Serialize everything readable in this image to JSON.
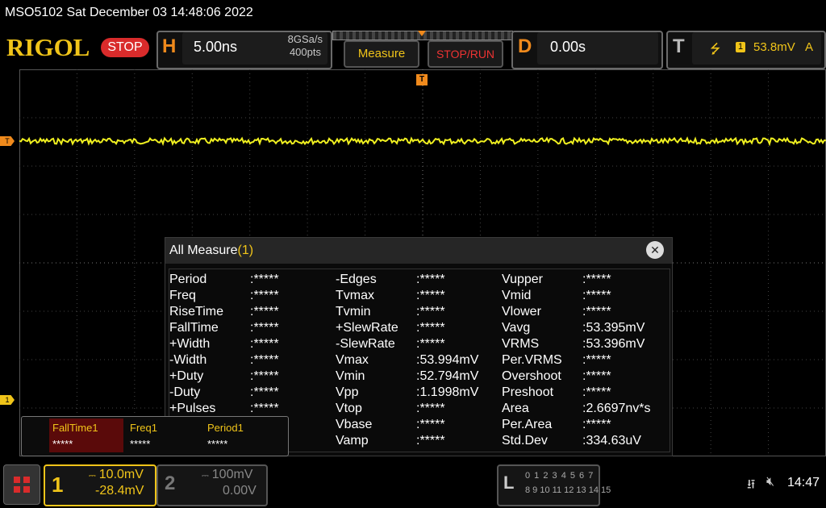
{
  "header": {
    "device_title": "MSO5102  Sat December 03 14:48:06 2022",
    "logo": "RIGOL",
    "run_state": "STOP"
  },
  "horizontal": {
    "letter": "H",
    "timebase": "5.00ns",
    "sample_rate": "8GSa/s",
    "points": "400pts"
  },
  "buttons": {
    "measure": "Measure",
    "stop_run": "STOP/RUN"
  },
  "delay": {
    "letter": "D",
    "value": "0.00s"
  },
  "trigger": {
    "letter": "T",
    "slope_icon": "rising-edge-icon",
    "source": "1",
    "level": "53.8mV",
    "mode": "A",
    "marker_label": "T",
    "channel_marker": "1"
  },
  "waveform": {
    "color": "#f0f020",
    "channel": 1
  },
  "all_measure": {
    "title": "All Measure",
    "count": "(1)",
    "columns": [
      [
        {
          "name": "Period",
          "value": ":*****"
        },
        {
          "name": "Freq",
          "value": ":*****"
        },
        {
          "name": "RiseTime",
          "value": ":*****"
        },
        {
          "name": "FallTime",
          "value": ":*****"
        },
        {
          "name": "+Width",
          "value": ":*****"
        },
        {
          "name": "-Width",
          "value": ":*****"
        },
        {
          "name": "+Duty",
          "value": ":*****"
        },
        {
          "name": "-Duty",
          "value": ":*****"
        },
        {
          "name": "+Pulses",
          "value": ":*****"
        }
      ],
      [
        {
          "name": "-Edges",
          "value": ":*****"
        },
        {
          "name": "Tvmax",
          "value": ":*****"
        },
        {
          "name": "Tvmin",
          "value": ":*****"
        },
        {
          "name": "+SlewRate",
          "value": ":*****"
        },
        {
          "name": "-SlewRate",
          "value": ":*****"
        },
        {
          "name": "Vmax",
          "value": ":53.994mV"
        },
        {
          "name": "Vmin",
          "value": ":52.794mV"
        },
        {
          "name": "Vpp",
          "value": ":1.1998mV"
        },
        {
          "name": "Vtop",
          "value": ":*****"
        },
        {
          "name": "Vbase",
          "value": ":*****"
        },
        {
          "name": "Vamp",
          "value": ":*****"
        }
      ],
      [
        {
          "name": "Vupper",
          "value": ":*****"
        },
        {
          "name": "Vmid",
          "value": ":*****"
        },
        {
          "name": "Vlower",
          "value": ":*****"
        },
        {
          "name": "Vavg",
          "value": ":53.395mV"
        },
        {
          "name": "VRMS",
          "value": ":53.396mV"
        },
        {
          "name": "Per.VRMS",
          "value": ":*****"
        },
        {
          "name": "Overshoot",
          "value": ":*****"
        },
        {
          "name": "Preshoot",
          "value": ":*****"
        },
        {
          "name": "Area",
          "value": ":2.6697nv*s"
        },
        {
          "name": "Per.Area",
          "value": ":*****"
        },
        {
          "name": "Std.Dev",
          "value": ":334.63uV"
        }
      ]
    ]
  },
  "mini_measure": [
    {
      "name": "FallTime1",
      "value": "*****"
    },
    {
      "name": "Freq1",
      "value": "*****"
    },
    {
      "name": "Period1",
      "value": "*****"
    }
  ],
  "channels": [
    {
      "num": "1",
      "scale": "10.0mV",
      "offset": "-28.4mV"
    },
    {
      "num": "2",
      "scale": "100mV",
      "offset": "0.00V"
    }
  ],
  "la": {
    "letter": "L",
    "row1": "0 1 2 3  4 5 6 7",
    "row2": "8 9 10 11 12 13 14 15"
  },
  "status": {
    "usb_icon": "usb-icon",
    "speaker_icon": "speaker-muted-icon",
    "clock": "14:47"
  }
}
